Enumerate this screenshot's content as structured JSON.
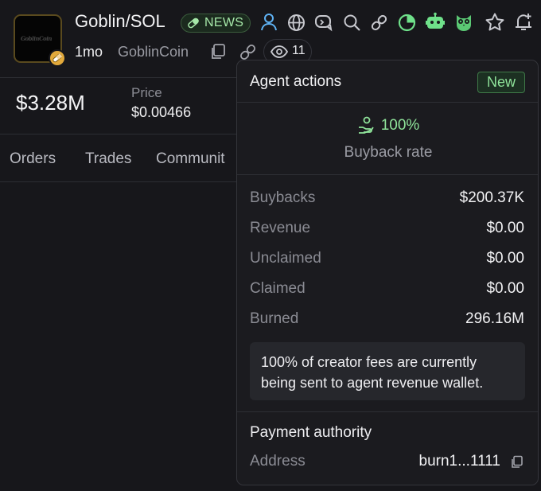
{
  "header": {
    "avatar_text": "GoblinCoin",
    "pair": "Goblin/SOL",
    "news_badge": "NEWS",
    "age": "1mo",
    "symbol_name": "GoblinCoin",
    "watchers": "11",
    "icons": [
      "user-icon",
      "globe-icon",
      "chat-icon",
      "search-icon",
      "link-icon",
      "pie-chart-icon",
      "robot-icon",
      "owl-icon",
      "star-icon",
      "bell-plus-icon"
    ]
  },
  "stats": {
    "market_cap": "$3.28M",
    "price_label": "Price",
    "price_value": "$0.00466"
  },
  "tabs": [
    "Orders",
    "Trades",
    "Communit"
  ],
  "popover": {
    "title": "Agent actions",
    "badge": "New",
    "buyback_rate": "100%",
    "buyback_label": "Buyback rate",
    "rows": [
      {
        "label": "Buybacks",
        "value": "$200.37K"
      },
      {
        "label": "Revenue",
        "value": "$0.00"
      },
      {
        "label": "Unclaimed",
        "value": "$0.00"
      },
      {
        "label": "Claimed",
        "value": "$0.00"
      },
      {
        "label": "Burned",
        "value": "296.16M"
      }
    ],
    "note": "100% of creator fees are currently being sent to agent revenue wallet.",
    "payment_title": "Payment authority",
    "address_label": "Address",
    "address_value": "burn1...1111"
  },
  "colors": {
    "accent_green": "#8fe39a",
    "background": "#17171b",
    "popover_bg": "#1b1b1f"
  }
}
